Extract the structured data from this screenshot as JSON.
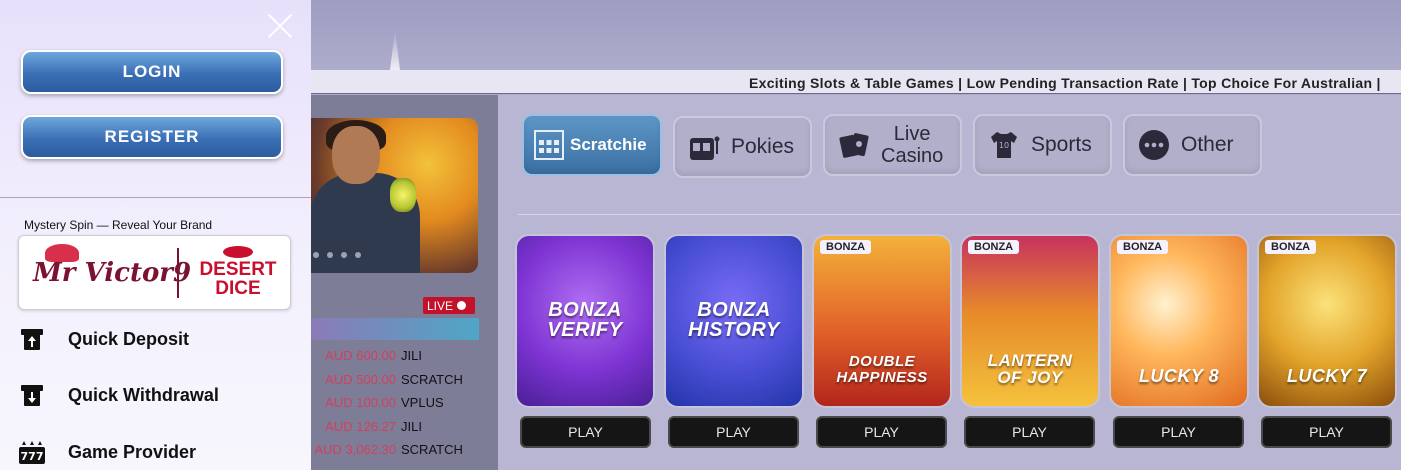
{
  "drawer": {
    "login_label": "LOGIN",
    "register_label": "REGISTER",
    "mystery_label": "Mystery Spin — Reveal Your Brand",
    "brand_a": "Mr Victor9",
    "brand_b_line1": "DESERT",
    "brand_b_line2": "DICE",
    "menu": [
      {
        "label": "Quick Deposit",
        "icon": "deposit-icon"
      },
      {
        "label": "Quick Withdrawal",
        "icon": "withdrawal-icon"
      },
      {
        "label": "Game Provider",
        "icon": "slot-777-icon"
      }
    ]
  },
  "marquee": {
    "text": "Exciting Slots & Table Games | Low Pending Transaction Rate | Top Choice For Australian |"
  },
  "live": {
    "badge": "LIVE",
    "winners": [
      {
        "amount": "AUD 600.00",
        "provider": "JILI"
      },
      {
        "amount": "AUD 500.00",
        "provider": "SCRATCH"
      },
      {
        "amount": "AUD 100.00",
        "provider": "VPLUS"
      },
      {
        "amount": "AUD 126.27",
        "provider": "JILI"
      },
      {
        "amount": "AUD 3,062.30",
        "provider": "SCRATCH"
      }
    ]
  },
  "categories": [
    {
      "label": "Scratchie",
      "icon": "scratch-card-icon",
      "active": true
    },
    {
      "label": "Pokies",
      "icon": "slot-machine-icon",
      "active": false
    },
    {
      "label_line1": "Live",
      "label_line2": "Casino",
      "icon": "playing-cards-icon",
      "active": false
    },
    {
      "label": "Sports",
      "icon": "jersey-icon",
      "active": false
    },
    {
      "label": "Other",
      "icon": "more-dots-icon",
      "active": false
    }
  ],
  "games": [
    {
      "title_line1": "BONZA",
      "title_line2": "VERIFY",
      "tag": "",
      "play": "PLAY",
      "colors": [
        "#8b3fd9",
        "#5a2aa8"
      ]
    },
    {
      "title_line1": "BONZA",
      "title_line2": "HISTORY",
      "tag": "",
      "play": "PLAY",
      "colors": [
        "#6b5cf0",
        "#2f3bb5"
      ]
    },
    {
      "title_line1": "DOUBLE",
      "title_line2": "HAPPINESS",
      "tag": "BONZA",
      "play": "PLAY",
      "colors": [
        "#f0a21e",
        "#c7461a"
      ]
    },
    {
      "title_line1": "LANTERN",
      "title_line2": "OF JOY",
      "tag": "BONZA",
      "play": "PLAY",
      "colors": [
        "#f6c13a",
        "#b32d63"
      ]
    },
    {
      "title_line1": "LUCKY 8",
      "title_line2": "",
      "tag": "BONZA",
      "play": "PLAY",
      "colors": [
        "#ffb44a",
        "#e06a1e"
      ]
    },
    {
      "title_line1": "LUCKY 7",
      "title_line2": "",
      "tag": "BONZA",
      "play": "PLAY",
      "colors": [
        "#f4c742",
        "#a8600e"
      ]
    }
  ]
}
